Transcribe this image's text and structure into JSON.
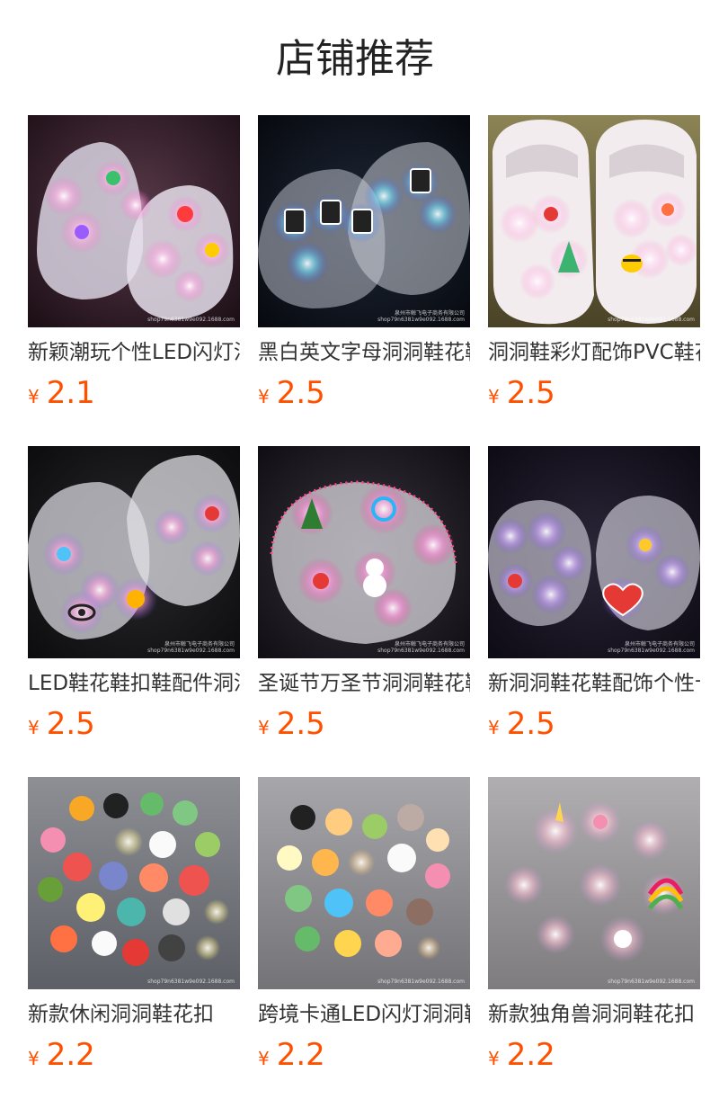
{
  "section": {
    "title": "店铺推荐"
  },
  "colors": {
    "price": "#ff5000",
    "title_text": "#333333",
    "heading": "#222222"
  },
  "products": [
    {
      "title": "新颖潮玩个性LED闪灯洞洞鞋花鞋扣",
      "currency": "¥",
      "price": "2.1",
      "watermark": "shop79n6381w9e092.1688.com",
      "icon": "glowing-clog-charms"
    },
    {
      "title": "黑白英文字母洞洞鞋花鞋扣配饰",
      "currency": "¥",
      "price": "2.5",
      "watermark_company": "泉州市鲸飞电子商务有限公司",
      "watermark": "shop79n6381w9e092.1688.com",
      "icon": "letter-clog-charms"
    },
    {
      "title": "洞洞鞋彩灯配饰PVC鞋花",
      "currency": "¥",
      "price": "2.5",
      "watermark": "shop79n6381w9e092.1688.com",
      "icon": "christmas-clog-charms"
    },
    {
      "title": "LED鞋花鞋扣鞋配件洞洞鞋",
      "currency": "¥",
      "price": "2.5",
      "watermark_company": "泉州市鲸飞电子商务有限公司",
      "watermark": "shop79n6381w9e092.1688.com",
      "icon": "flower-clog-charms"
    },
    {
      "title": "圣诞节万圣节洞洞鞋花鞋扣",
      "currency": "¥",
      "price": "2.5",
      "watermark_company": "泉州市鲸飞电子商务有限公司",
      "watermark": "shop79n6381w9e092.1688.com",
      "icon": "holiday-clog-charms"
    },
    {
      "title": "新洞洞鞋花鞋配饰个性卡通",
      "currency": "¥",
      "price": "2.5",
      "watermark_company": "泉州市鲸飞电子商务有限公司",
      "watermark": "shop79n6381w9e092.1688.com",
      "icon": "heart-clog-charms"
    },
    {
      "title": "新款休闲洞洞鞋花扣",
      "currency": "¥",
      "price": "2.2",
      "watermark": "shop79n6381w9e092.1688.com",
      "icon": "assorted-charms"
    },
    {
      "title": "跨境卡通LED闪灯洞洞鞋花",
      "currency": "¥",
      "price": "2.2",
      "watermark": "shop79n6381w9e092.1688.com",
      "icon": "animal-charms"
    },
    {
      "title": "新款独角兽洞洞鞋花扣",
      "currency": "¥",
      "price": "2.2",
      "watermark": "shop79n6381w9e092.1688.com",
      "icon": "unicorn-charms"
    }
  ]
}
